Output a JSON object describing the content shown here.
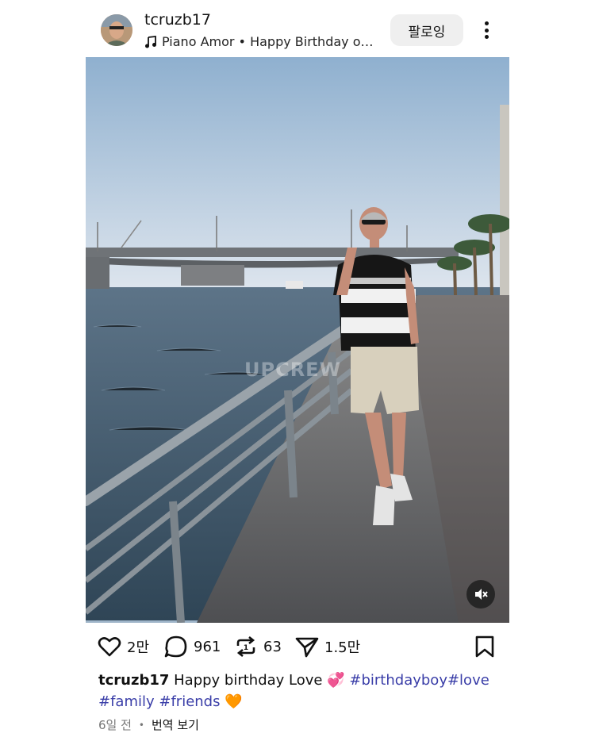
{
  "post": {
    "username": "tcruzb17",
    "music_text": "Piano Amor • Happy Birthday on…",
    "follow_label": "팔로잉"
  },
  "media": {
    "watermark": "UPCREW"
  },
  "actions": {
    "likes": "2만",
    "comments": "961",
    "reposts": "63",
    "shares": "1.5만"
  },
  "caption": {
    "username": "tcruzb17",
    "text": "Happy birthday Love",
    "emoji_heart": "💞",
    "tag1": "#birthdayboy",
    "tag2": "#love",
    "tag3": "#family",
    "tag4": "#friends",
    "emoji_orange_heart": "🧡"
  },
  "footer": {
    "time": "6일 전",
    "separator": "•",
    "translate_label": "번역 보기"
  },
  "icons": {
    "note": "music-note-icon",
    "more": "more-vertical-icon",
    "like": "heart-icon",
    "comment": "comment-icon",
    "repost": "repost-icon",
    "share": "share-icon",
    "bookmark": "bookmark-icon",
    "mute": "mute-icon"
  },
  "colors": {
    "hashtag": "#3a3ea8",
    "follow_bg": "#efefef"
  }
}
